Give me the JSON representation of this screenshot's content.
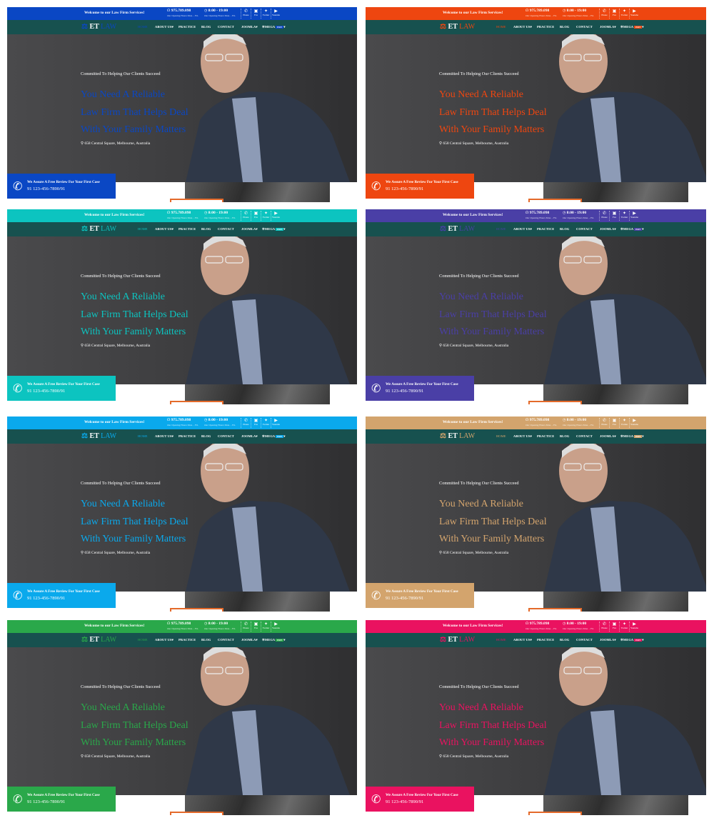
{
  "content": {
    "welcome": "Welcome to our Law Firm Services!",
    "phone_number": "975.789.098",
    "hours_time": "8:00 - 19:00",
    "hours_label": "Our Opening Hours Mon. - Fri.",
    "icons": [
      {
        "icon": "phone-icon",
        "label": "Phone",
        "glyph": "✆"
      },
      {
        "icon": "fax-icon",
        "label": "Fax",
        "glyph": "▣"
      },
      {
        "icon": "twitter-icon",
        "label": "Twitter",
        "glyph": "✦"
      },
      {
        "icon": "youtube-icon",
        "label": "Youtube",
        "glyph": "▶"
      }
    ],
    "logo_et": "ET",
    "logo_law": "LAW",
    "nav": [
      "HOME",
      "ABOUT US",
      "PRACTICE",
      "BLOG",
      "CONTACT",
      "JOOMLA",
      "MEGA"
    ],
    "mega_badge": "HOT",
    "subtitle": "Committed To Helping Our Clients Succeed",
    "headline": [
      "You Need A Reliable",
      "Law Firm That Helps Deal",
      "With Your Family Matters"
    ],
    "address": "658 Central Square, Melbourne, Australia",
    "call_title": "We Assure A Free Review For Your First Case",
    "call_number": "91 123-456-7890/91"
  },
  "themes": [
    {
      "name": "blue",
      "accent": "#0a47c4"
    },
    {
      "name": "orange",
      "accent": "#ee4610"
    },
    {
      "name": "teal",
      "accent": "#0cc4c0"
    },
    {
      "name": "purple",
      "accent": "#4a3fa6"
    },
    {
      "name": "sky",
      "accent": "#0aa9ec"
    },
    {
      "name": "tan",
      "accent": "#d3a46d"
    },
    {
      "name": "green",
      "accent": "#2aa84a"
    },
    {
      "name": "pink",
      "accent": "#ea1260"
    }
  ]
}
